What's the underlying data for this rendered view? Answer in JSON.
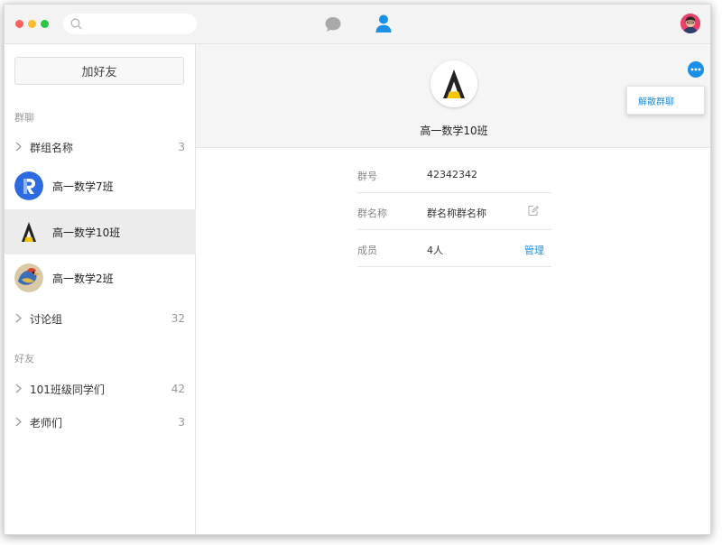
{
  "search": {
    "placeholder": ""
  },
  "sidebar": {
    "add_friend_label": "加好友",
    "group_chats_title": "群聊",
    "group_name_row": {
      "label": "群组名称",
      "count": "3"
    },
    "chats": [
      {
        "name": "高一数学7班",
        "avatar": "r-logo"
      },
      {
        "name": "高一数学10班",
        "avatar": "a-logo"
      },
      {
        "name": "高一数学2班",
        "avatar": "bird-photo"
      }
    ],
    "discussion_row": {
      "label": "讨论组",
      "count": "32"
    },
    "friends_title": "好友",
    "friend_groups": [
      {
        "label": "101班级同学们",
        "count": "42"
      },
      {
        "label": "老师们",
        "count": "3"
      }
    ]
  },
  "profile": {
    "name": "高一数学10班",
    "menu_item": "解散群聊",
    "rows": {
      "group_id": {
        "key": "群号",
        "value": "42342342"
      },
      "group_name": {
        "key": "群名称",
        "value": "群名称群名称"
      },
      "members": {
        "key": "成员",
        "value": "4人",
        "action": "管理"
      }
    }
  },
  "colors": {
    "accent": "#1c8fe6",
    "active_bg": "#ececec"
  }
}
